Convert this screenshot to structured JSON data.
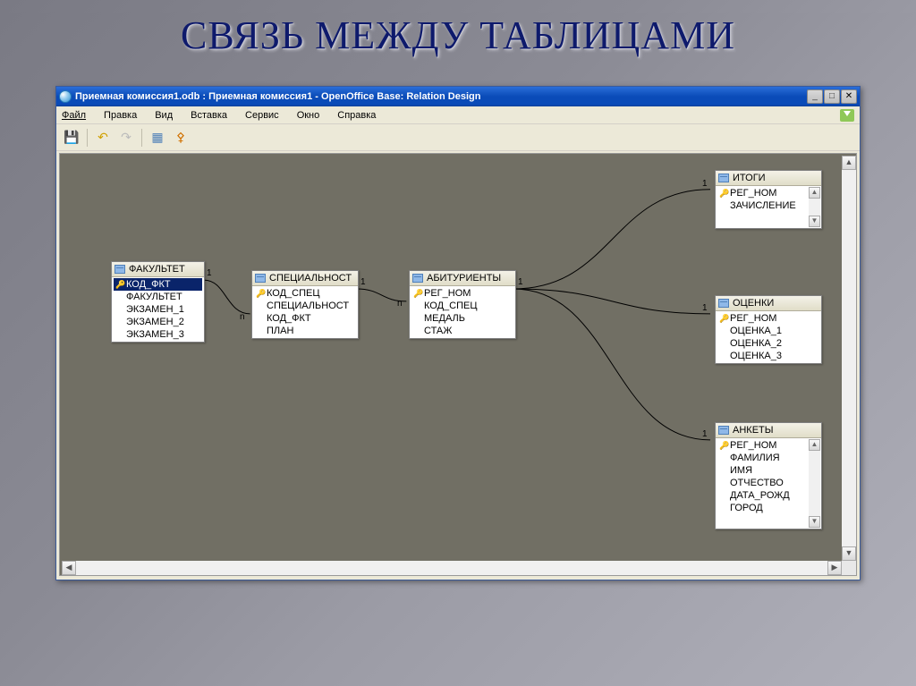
{
  "page_title": "СВЯЗЬ МЕЖДУ ТАБЛИЦАМИ",
  "window": {
    "title": "Приемная комиссия1.odb : Приемная комиссия1 - OpenOffice Base: Relation Design"
  },
  "menu": {
    "file": "Файл",
    "edit": "Правка",
    "view": "Вид",
    "insert": "Вставка",
    "tools": "Сервис",
    "window": "Окно",
    "help": "Справка"
  },
  "tables": {
    "fakultet": {
      "title": "ФАКУЛЬТЕТ",
      "fields": [
        "КОД_ФКТ",
        "ФАКУЛЬТЕТ",
        "ЭКЗАМЕН_1",
        "ЭКЗАМЕН_2",
        "ЭКЗАМЕН_3"
      ],
      "key_index": 0,
      "selected_index": 0
    },
    "specialnost": {
      "title": "СПЕЦИАЛЬНОСТ",
      "fields": [
        "КОД_СПЕЦ",
        "СПЕЦИАЛЬНОСТ",
        "КОД_ФКТ",
        "ПЛАН"
      ],
      "key_index": 0
    },
    "abiturienty": {
      "title": "АБИТУРИЕНТЫ",
      "fields": [
        "РЕГ_НОМ",
        "КОД_СПЕЦ",
        "МЕДАЛЬ",
        "СТАЖ"
      ],
      "key_index": 0
    },
    "itogi": {
      "title": "ИТОГИ",
      "fields": [
        "РЕГ_НОМ",
        "ЗАЧИСЛЕНИЕ"
      ],
      "key_index": 0
    },
    "ocenki": {
      "title": "ОЦЕНКИ",
      "fields": [
        "РЕГ_НОМ",
        "ОЦЕНКА_1",
        "ОЦЕНКА_2",
        "ОЦЕНКА_3"
      ],
      "key_index": 0
    },
    "ankety": {
      "title": "АНКЕТЫ",
      "fields": [
        "РЕГ_НОМ",
        "ФАМИЛИЯ",
        "ИМЯ",
        "ОТЧЕСТВО",
        "ДАТА_РОЖД",
        "ГОРОД"
      ],
      "key_index": 0
    }
  },
  "cardinality": {
    "one": "1",
    "many": "n"
  }
}
